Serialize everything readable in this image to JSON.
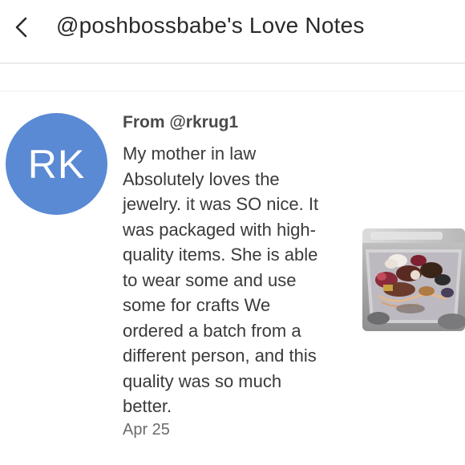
{
  "header": {
    "title": "@poshbossbabe's Love Notes",
    "back_icon": "chevron-left-icon"
  },
  "note": {
    "avatar_initials": "RK",
    "avatar_color": "#5b8ad4",
    "from": "From @rkrug1",
    "message_lines": [
      "My mother in law",
      "Absolutely loves the",
      "jewelry. it was SO nice. It",
      "was packaged with high-",
      "quality items. She is able",
      "to wear some and use",
      "some for crafts We",
      "ordered a batch from a",
      "different person, and this",
      "quality was so much",
      "better."
    ],
    "date": "Apr 25",
    "photo": "jewelry-box-photo"
  }
}
